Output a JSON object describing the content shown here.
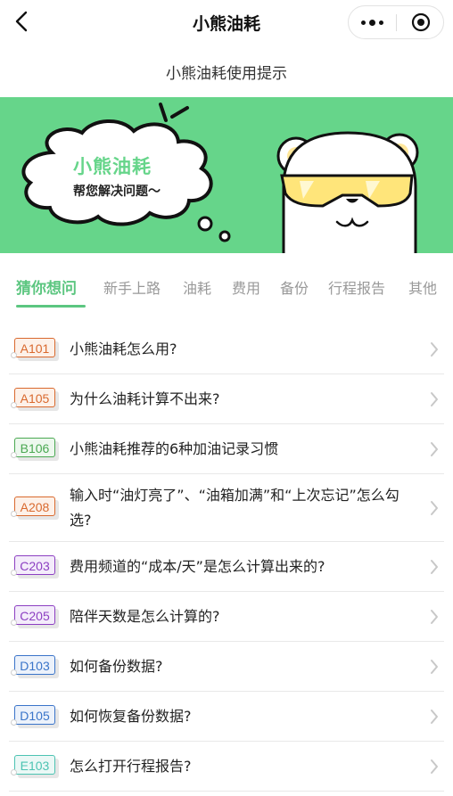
{
  "nav": {
    "title": "小熊油耗"
  },
  "subtitle": "小熊油耗使用提示",
  "banner": {
    "title": "小熊油耗",
    "subtitle": "帮您解决问题～"
  },
  "tabs": [
    "猜你想问",
    "新手上路",
    "油耗",
    "费用",
    "备份",
    "行程报告",
    "其他"
  ],
  "active_tab": 0,
  "questions": [
    {
      "code": "A101",
      "color": "#d9692e",
      "bg": "#fdf1e9",
      "text": "小熊油耗怎么用?"
    },
    {
      "code": "A105",
      "color": "#d9692e",
      "bg": "#fdf1e9",
      "text": "为什么油耗计算不出来?"
    },
    {
      "code": "B106",
      "color": "#4aa852",
      "bg": "#edf8ee",
      "text": "小熊油耗推荐的6种加油记录习惯"
    },
    {
      "code": "A208",
      "color": "#d9692e",
      "bg": "#fdf1e9",
      "text": "输入时“油灯亮了”、“油箱加满”和“上次忘记”怎么勾选?"
    },
    {
      "code": "C203",
      "color": "#8c3fc2",
      "bg": "#f4ecfb",
      "text": "费用频道的“成本/天”是怎么计算出来的?"
    },
    {
      "code": "C205",
      "color": "#8c3fc2",
      "bg": "#f4ecfb",
      "text": "陪伴天数是怎么计算的?"
    },
    {
      "code": "D103",
      "color": "#3a74c9",
      "bg": "#ecf2fb",
      "text": "如何备份数据?"
    },
    {
      "code": "D105",
      "color": "#3a74c9",
      "bg": "#ecf2fb",
      "text": "如何恢复备份数据?"
    },
    {
      "code": "E103",
      "color": "#4cc3b2",
      "bg": "#ebf8f6",
      "text": "怎么打开行程报告?"
    }
  ]
}
